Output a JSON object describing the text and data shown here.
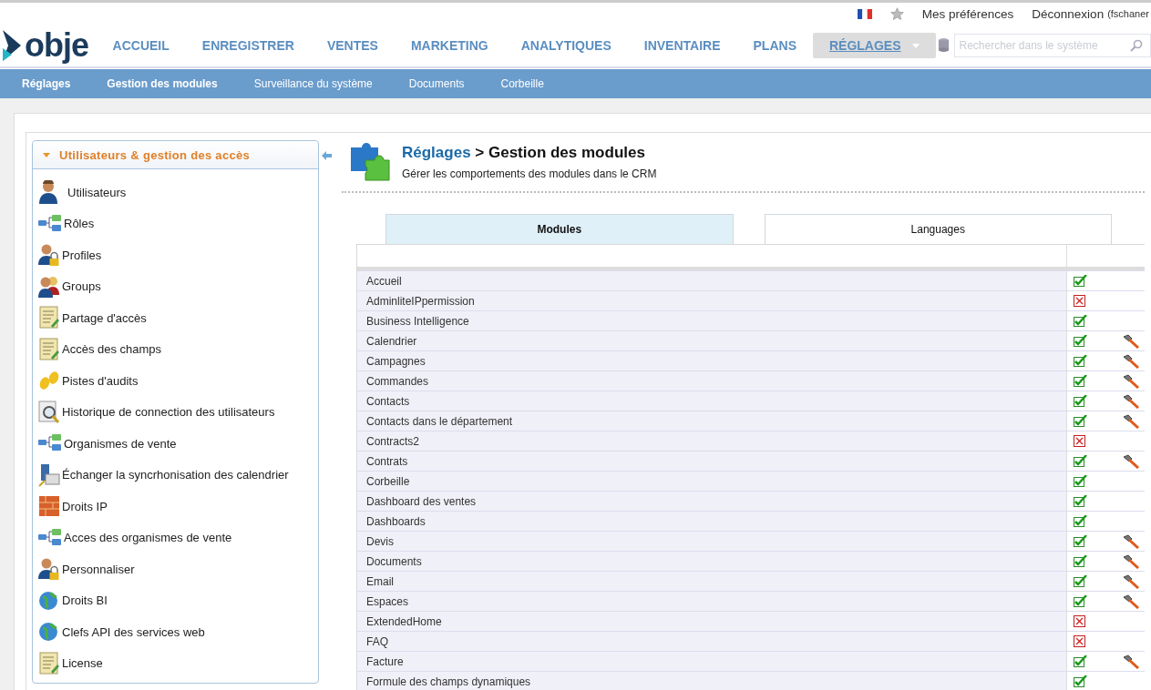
{
  "topbar": {
    "links": [
      "Mes préférences",
      "Déconnexion"
    ],
    "user": "(fschaner"
  },
  "logo": "obje",
  "nav": [
    {
      "label": "ACCUEIL",
      "selected": false
    },
    {
      "label": "ENREGISTRER",
      "selected": false
    },
    {
      "label": "VENTES",
      "selected": false
    },
    {
      "label": "MARKETING",
      "selected": false
    },
    {
      "label": "ANALYTIQUES",
      "selected": false
    },
    {
      "label": "INVENTAIRE",
      "selected": false
    },
    {
      "label": "PLANS",
      "selected": false
    },
    {
      "label": "RÉGLAGES",
      "selected": true
    }
  ],
  "search": {
    "placeholder": "Rechercher dans le système"
  },
  "subnav": [
    {
      "label": "Réglages",
      "selected": true
    },
    {
      "label": "Gestion des modules",
      "selected": true
    },
    {
      "label": "Surveillance du système",
      "selected": false
    },
    {
      "label": "Documents",
      "selected": false
    },
    {
      "label": "Corbeille",
      "selected": false
    }
  ],
  "sidebar": {
    "title": "Utilisateurs & gestion des accès",
    "expanded": true,
    "items": [
      {
        "label": "Utilisateurs",
        "kind": "person"
      },
      {
        "label": "Rôles",
        "kind": "network"
      },
      {
        "label": "Profiles",
        "kind": "lock"
      },
      {
        "label": "Groups",
        "kind": "group"
      },
      {
        "label": "Partage d'accès",
        "kind": "document"
      },
      {
        "label": "Accès des champs",
        "kind": "document"
      },
      {
        "label": "Pistes d'audits",
        "kind": "footprints"
      },
      {
        "label": "Historique de connection des utilisateurs",
        "kind": "magnifier"
      },
      {
        "label": "Organismes de vente",
        "kind": "network"
      },
      {
        "label": "Échanger la syncrhonisation des calendrier",
        "kind": "server"
      },
      {
        "label": "Droits IP",
        "kind": "wall"
      },
      {
        "label": "Acces des organismes de vente",
        "kind": "network"
      },
      {
        "label": "Personnaliser",
        "kind": "lock"
      },
      {
        "label": "Droits BI",
        "kind": "globe"
      },
      {
        "label": "Clefs API des services web",
        "kind": "globe"
      },
      {
        "label": "License",
        "kind": "document"
      }
    ]
  },
  "header": {
    "breadcrumb": "Réglages",
    "title": "> Gestion des modules",
    "subtitle": "Gérer les comportements des modules dans le CRM"
  },
  "tabs": [
    {
      "label": "Modules",
      "selected": true
    },
    {
      "label": "Languages",
      "selected": false
    }
  ],
  "modules": [
    {
      "name": "Accueil",
      "enabled": true,
      "configurable": false
    },
    {
      "name": "AdminliteIPpermission",
      "enabled": false,
      "configurable": false
    },
    {
      "name": "Business Intelligence",
      "enabled": true,
      "configurable": false
    },
    {
      "name": "Calendrier",
      "enabled": true,
      "configurable": true
    },
    {
      "name": "Campagnes",
      "enabled": true,
      "configurable": true
    },
    {
      "name": "Commandes",
      "enabled": true,
      "configurable": true
    },
    {
      "name": "Contacts",
      "enabled": true,
      "configurable": true
    },
    {
      "name": "Contacts dans le département",
      "enabled": true,
      "configurable": true
    },
    {
      "name": "Contracts2",
      "enabled": false,
      "configurable": false
    },
    {
      "name": "Contrats",
      "enabled": true,
      "configurable": true
    },
    {
      "name": "Corbeille",
      "enabled": true,
      "configurable": false
    },
    {
      "name": "Dashboard des ventes",
      "enabled": true,
      "configurable": false
    },
    {
      "name": "Dashboards",
      "enabled": true,
      "configurable": false
    },
    {
      "name": "Devis",
      "enabled": true,
      "configurable": true
    },
    {
      "name": "Documents",
      "enabled": true,
      "configurable": true
    },
    {
      "name": "Email",
      "enabled": true,
      "configurable": true
    },
    {
      "name": "Espaces",
      "enabled": true,
      "configurable": true
    },
    {
      "name": "ExtendedHome",
      "enabled": false,
      "configurable": false
    },
    {
      "name": "FAQ",
      "enabled": false,
      "configurable": false
    },
    {
      "name": "Facture",
      "enabled": true,
      "configurable": true
    },
    {
      "name": "Formule des champs dynamiques",
      "enabled": true,
      "configurable": false
    }
  ]
}
